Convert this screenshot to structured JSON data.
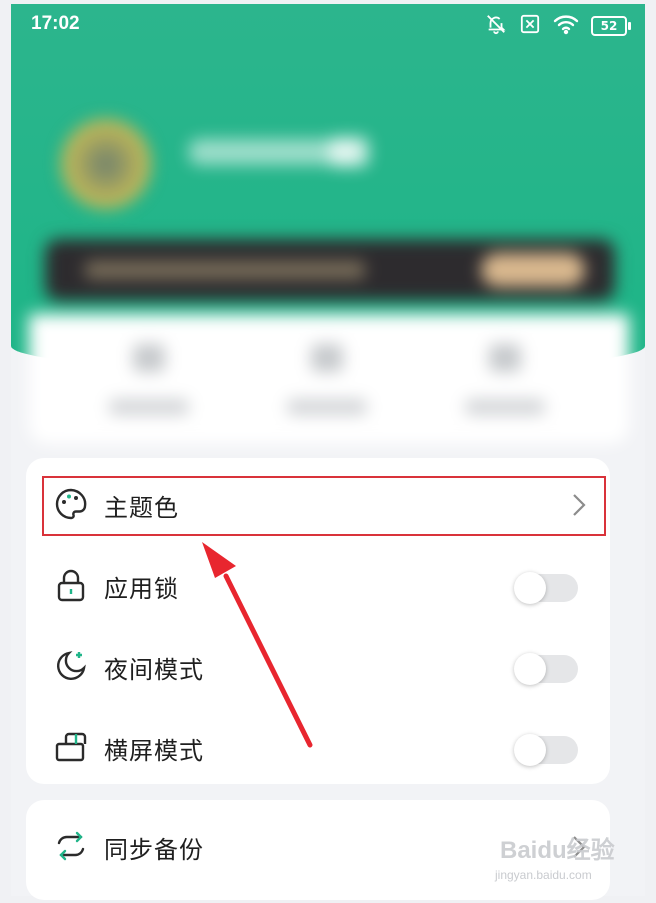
{
  "status_bar": {
    "time": "17:02",
    "battery": "52"
  },
  "settings": {
    "items": [
      {
        "label": "主题色",
        "icon": "palette-icon",
        "control": "chevron"
      },
      {
        "label": "应用锁",
        "icon": "lock-icon",
        "control": "toggle",
        "on": false
      },
      {
        "label": "夜间模式",
        "icon": "moon-icon",
        "control": "toggle",
        "on": false
      },
      {
        "label": "横屏模式",
        "icon": "landscape-icon",
        "control": "toggle",
        "on": false
      }
    ],
    "backup": {
      "label": "同步备份",
      "icon": "sync-icon",
      "control": "chevron"
    }
  },
  "watermark": {
    "text": "Baidu经验",
    "url": "jingyan.baidu.com"
  },
  "colors": {
    "brand_green": "#20b589",
    "highlight_red": "#d9323a",
    "icon_gray": "#2b2b2b"
  }
}
